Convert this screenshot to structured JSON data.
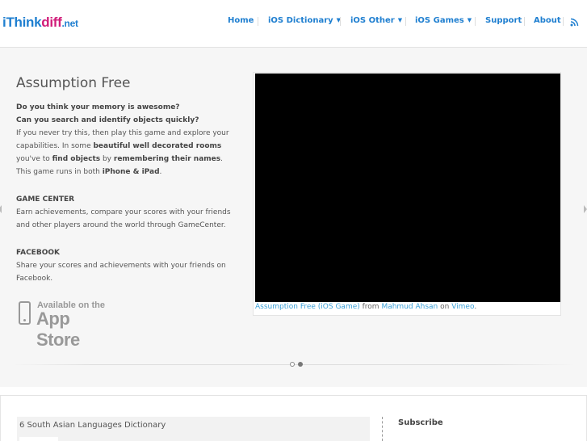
{
  "logo": {
    "part1": "i",
    "part2": "Think",
    "part3": "diff",
    "part4": ".net"
  },
  "nav": {
    "items": [
      {
        "label": "Home"
      },
      {
        "label": "iOS Dictionary"
      },
      {
        "label": "iOS Other"
      },
      {
        "label": "iOS Games"
      },
      {
        "label": "Support"
      },
      {
        "label": "About"
      }
    ],
    "rss_icon": "rss-icon",
    "dropdown_icon": "chevron-down-icon"
  },
  "slide": {
    "title": "Assumption Free",
    "q1": "Do you think your memory is awesome?",
    "q2": "Can you search and identify objects quickly?",
    "p1_a": "If you never try this, then play this game and explore your capabilities. In some ",
    "p1_b": "beautiful well decorated rooms",
    "p1_c": " you've to ",
    "p1_d": "find objects",
    "p1_e": " by ",
    "p1_f": "remembering their names",
    "p1_g": ". This game runs in both ",
    "p1_h": "iPhone & iPad",
    "p1_i": ".",
    "gc_head": "GAME CENTER",
    "gc_text": "Earn achievements, compare your scores with your friends and other players around the world through GameCenter.",
    "fb_head": "FACEBOOK",
    "fb_text": "Share your scores and achievements with your friends on Facebook.",
    "appstore_line1": "Available on the",
    "appstore_line2": "App Store",
    "caption_link1": "Assumption Free (iOS Game)",
    "caption_from": " from ",
    "caption_link2": "Mahmud Ahsan",
    "caption_on": " on ",
    "caption_link3": "Vimeo",
    "caption_end": "."
  },
  "content": {
    "post_title": "6 South Asian Languages Dictionary",
    "subscribe": "Subscribe"
  },
  "colors": {
    "accent": "#1f7fd0",
    "brand_pink": "#d11d7a",
    "link": "#3aa0d8"
  }
}
